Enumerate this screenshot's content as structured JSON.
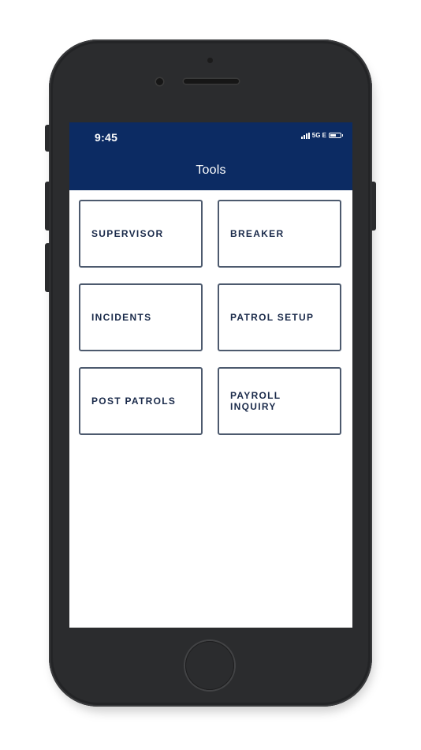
{
  "status_bar": {
    "time": "9:45",
    "network": "5G E"
  },
  "header": {
    "title": "Tools"
  },
  "tiles": [
    {
      "label": "SUPERVISOR"
    },
    {
      "label": "BREAKER"
    },
    {
      "label": "INCIDENTS"
    },
    {
      "label": "PATROL SETUP"
    },
    {
      "label": "POST PATROLS"
    },
    {
      "label": "PAYROLL\nINQUIRY"
    }
  ],
  "colors": {
    "header_background": "#0c2b63",
    "tile_border": "#4d5a6e",
    "tile_text": "#1a2a4a",
    "phone_body": "#2b2c2e"
  }
}
